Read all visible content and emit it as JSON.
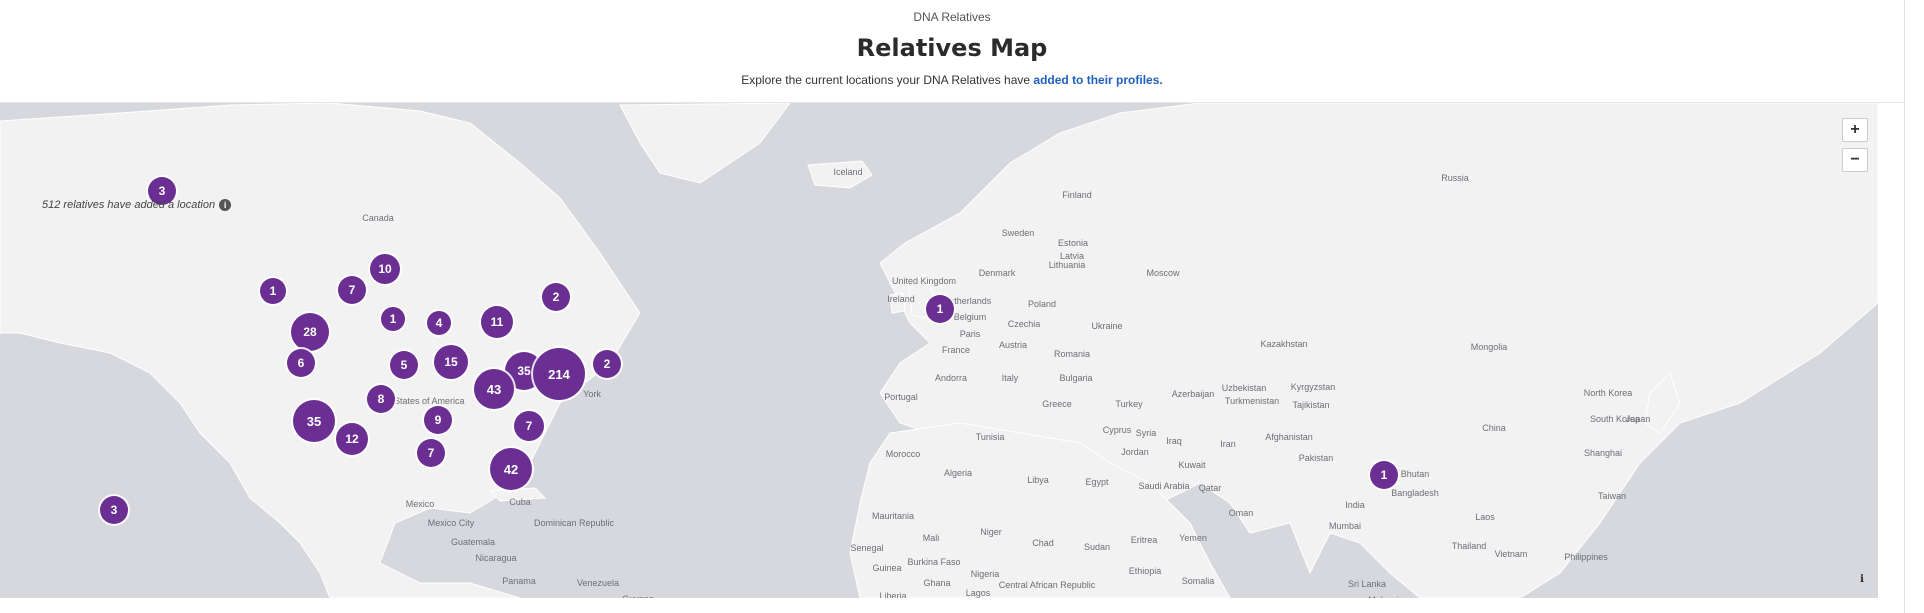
{
  "header": {
    "eyebrow": "DNA Relatives",
    "title": "Relatives Map",
    "subtitle_text": "Explore the current locations your DNA Relatives have ",
    "subtitle_link": "added to their profiles."
  },
  "map": {
    "count_note": "512 relatives have added a location",
    "info_glyph": "i",
    "zoom_in": "+",
    "zoom_out": "−",
    "attribution_glyph": "i",
    "colors": {
      "marker": "#6b2f94",
      "land": "#f2f2f3",
      "water": "#d6d8dd"
    },
    "labels": [
      "Canada",
      "United States of America",
      "Mexico",
      "Mexico City",
      "Cuba",
      "Dominican Republic",
      "Guatemala",
      "Nicaragua",
      "Panama",
      "Venezuela",
      "Guyana",
      "York",
      "Iceland",
      "Finland",
      "Sweden",
      "Estonia",
      "Latvia",
      "Lithuania",
      "Denmark",
      "United Kingdom",
      "Ireland",
      "Netherlands",
      "Belgium",
      "Paris",
      "France",
      "Czechia",
      "Poland",
      "Ukraine",
      "Austria",
      "Romania",
      "Andorra",
      "Italy",
      "Bulgaria",
      "Portugal",
      "Greece",
      "Turkey",
      "Moscow",
      "Russia",
      "Kazakhstan",
      "Mongolia",
      "Uzbekistan",
      "Kyrgyzstan",
      "Turkmenistan",
      "Tajikistan",
      "Azerbaijan",
      "Cyprus",
      "Syria",
      "Iraq",
      "Iran",
      "Afghanistan",
      "Pakistan",
      "Jordan",
      "Kuwait",
      "Saudi Arabia",
      "Qatar",
      "Oman",
      "Yemen",
      "Tunisia",
      "Morocco",
      "Algeria",
      "Libya",
      "Egypt",
      "Mauritania",
      "Mali",
      "Niger",
      "Chad",
      "Sudan",
      "Eritrea",
      "Ethiopia",
      "Somalia",
      "Senegal",
      "Guinea",
      "Burkina Faso",
      "Ghana",
      "Nigeria",
      "Liberia",
      "Lagos",
      "Central African Republic",
      "India",
      "Mumbai",
      "Bhutan",
      "Bangladesh",
      "Sri Lanka",
      "Malaysia",
      "China",
      "North Korea",
      "South Korea",
      "Japan",
      "Shanghai",
      "Taiwan",
      "Laos",
      "Thailand",
      "Vietnam",
      "Philippines"
    ],
    "markers": [
      "3",
      "1",
      "7",
      "10",
      "1",
      "4",
      "11",
      "2",
      "28",
      "6",
      "5",
      "15",
      "35",
      "214",
      "2",
      "43",
      "8",
      "35",
      "12",
      "9",
      "7",
      "7",
      "42",
      "3",
      "1",
      "1"
    ]
  }
}
